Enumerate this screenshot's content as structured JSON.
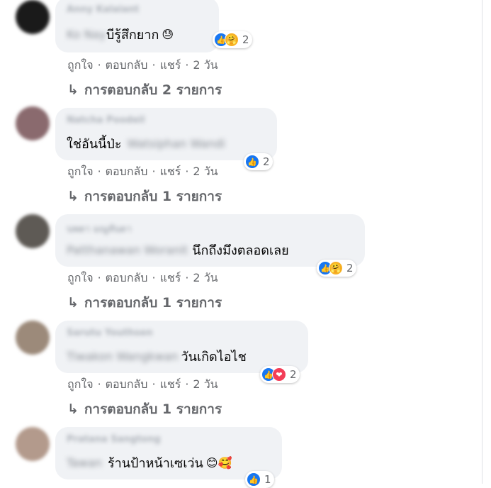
{
  "comments": [
    {
      "author": "Anny Kalaiant",
      "tagged": "Ko Nay",
      "text": "บีรู้สึกยาก",
      "emoji": "😓",
      "reactions": {
        "types": [
          "like",
          "care"
        ],
        "count": "2"
      },
      "actions": {
        "like": "ถูกใจ",
        "reply": "ตอบกลับ",
        "share": "แชร์",
        "time": "2 วัน"
      },
      "replies": "การตอบกลับ 2 รายการ",
      "avatar_color": "#1a1a1a"
    },
    {
      "author": "Natcha Poodeil",
      "tagged": "Watsiphan Wandi",
      "text": "ใช่อันนี้ป่ะ",
      "emoji": "",
      "reactions": {
        "types": [
          "like"
        ],
        "count": "2"
      },
      "actions": {
        "like": "ถูกใจ",
        "reply": "ตอบกลับ",
        "share": "แชร์",
        "time": "2 วัน"
      },
      "replies": "การตอบกลับ 1 รายการ",
      "avatar_color": "#8a6a6e"
    },
    {
      "author": "นพดา มณูทันดา",
      "tagged": "Patthanawan Woranit",
      "text": "นึกถึงมึงตลอดเลย",
      "emoji": "",
      "reactions": {
        "types": [
          "like",
          "care"
        ],
        "count": "2"
      },
      "actions": {
        "like": "ถูกใจ",
        "reply": "ตอบกลับ",
        "share": "แชร์",
        "time": "2 วัน"
      },
      "replies": "การตอบกลับ 1 รายการ",
      "avatar_color": "#5e5a55"
    },
    {
      "author": "Sarutu Youthsen",
      "tagged": "Tiwakon Wangkwan",
      "text": "วันเกิดไอไช",
      "emoji": "",
      "reactions": {
        "types": [
          "like",
          "love"
        ],
        "count": "2"
      },
      "actions": {
        "like": "ถูกใจ",
        "reply": "ตอบกลับ",
        "share": "แชร์",
        "time": "2 วัน"
      },
      "replies": "การตอบกลับ 1 รายการ",
      "avatar_color": "#9c8a7a"
    },
    {
      "author": "Pratana Sangtong",
      "tagged": "Tawan",
      "text": "ร้านป้าหน้าเซเว่น",
      "emoji": "😊🥰",
      "reactions": {
        "types": [
          "like"
        ],
        "count": "1"
      },
      "avatar_color": "#b39a8c"
    }
  ],
  "colors": {
    "bubble": "#f0f2f5",
    "like": "#1877f2",
    "love": "#f33e58",
    "care": "#f7b125",
    "meta": "#65676b"
  },
  "icons": {
    "like": "like-icon",
    "care": "care-icon",
    "love": "love-icon",
    "reply_arrow": "reply-arrow-icon"
  },
  "separator": "·"
}
